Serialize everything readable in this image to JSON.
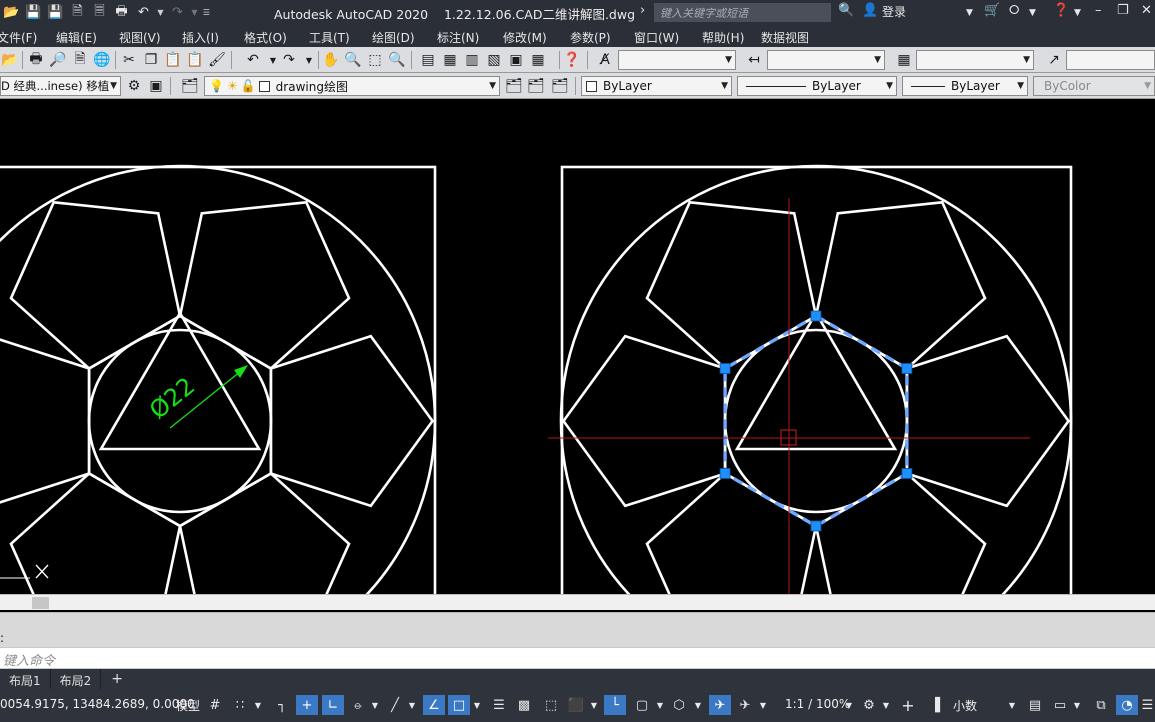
{
  "window": {
    "title": "Autodesk AutoCAD 2020    1.22.12.06.CAD二维讲解图.dwg",
    "search_placeholder": "键入关键字或短语",
    "login_label": "登录"
  },
  "menu": {
    "items": [
      "文件(F)",
      "编辑(E)",
      "视图(V)",
      "插入(I)",
      "格式(O)",
      "工具(T)",
      "绘图(D)",
      "标注(N)",
      "修改(M)",
      "参数(P)",
      "窗口(W)",
      "帮助(H)",
      "数据视图"
    ]
  },
  "toolbar2": {
    "workspace": "D 经典...inese) 移植",
    "layer": "drawing绘图",
    "color": "ByLayer",
    "linetype": "ByLayer",
    "lineweight": "ByLayer",
    "plotstyle": "ByColor"
  },
  "drawing": {
    "dimension_text": "Ø22",
    "colors": {
      "geometry": "#ffffff",
      "dimension": "#14e014",
      "crosshair": "#b01818",
      "grip": "#1f8fff",
      "selection": "#6fa8ff"
    }
  },
  "command": {
    "history_prompt": ":",
    "input_placeholder": "键入命令"
  },
  "tabs": {
    "items": [
      "布局1",
      "布局2"
    ],
    "add_label": "+"
  },
  "status": {
    "coordinates": "0054.9175, 13484.2689, 0.0000",
    "model_label": "模型",
    "scale_label": "1:1 / 100%",
    "units_label": "小数"
  }
}
